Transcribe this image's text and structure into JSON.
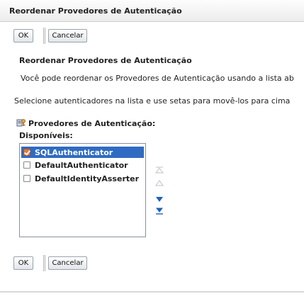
{
  "window": {
    "title": "Reordenar Provedores de Autenticação"
  },
  "buttons": {
    "ok_label": "OK",
    "cancel_label": "Cancelar"
  },
  "section": {
    "heading": "Reordenar Provedores de Autenticação",
    "description": "Você pode reordenar os Provedores de Autenticação usando a lista ab",
    "instructions": "Selecione autenticadores na lista e use setas para movê-los para cima"
  },
  "providers": {
    "label": "Provedores de Autenticação:",
    "available_label": "Disponíveis:",
    "items": [
      {
        "label": "SQLAuthenticator",
        "selected": true,
        "checked": true
      },
      {
        "label": "DefaultAuthenticator",
        "selected": false,
        "checked": false
      },
      {
        "label": "DefaultIdentityAsserter",
        "selected": false,
        "checked": false
      }
    ]
  },
  "icons": {
    "providers": "authentication-providers-icon",
    "move_top": "move-to-top-icon",
    "move_up": "move-up-icon",
    "move_down": "move-down-icon",
    "move_bottom": "move-to-bottom-icon"
  },
  "colors": {
    "selection": "#2f6bc3",
    "checked": "#e37a3c",
    "arrow_active": "#1f5fbf",
    "arrow_disabled": "#c8ccd2"
  }
}
